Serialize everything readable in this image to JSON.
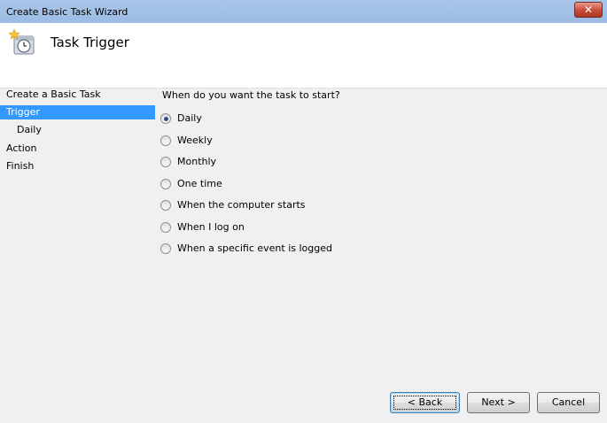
{
  "window": {
    "title": "Create Basic Task Wizard",
    "close_glyph": "✕"
  },
  "header": {
    "title": "Task Trigger",
    "icon": "clock-task-icon"
  },
  "steps": [
    {
      "label": "Create a Basic Task"
    },
    {
      "label": "Trigger"
    },
    {
      "label": "Daily"
    },
    {
      "label": "Action"
    },
    {
      "label": "Finish"
    }
  ],
  "form": {
    "question": "When do you want the task to start?",
    "selected": "Daily",
    "options": [
      {
        "label": "Daily"
      },
      {
        "label": "Weekly"
      },
      {
        "label": "Monthly"
      },
      {
        "label": "One time"
      },
      {
        "label": "When the computer starts"
      },
      {
        "label": "When I log on"
      },
      {
        "label": "When a specific event is logged"
      }
    ]
  },
  "buttons": {
    "back": "< Back",
    "next": "Next >",
    "cancel": "Cancel"
  },
  "colors": {
    "selection": "#3399ff",
    "titlebar": "#a9c6e8"
  }
}
